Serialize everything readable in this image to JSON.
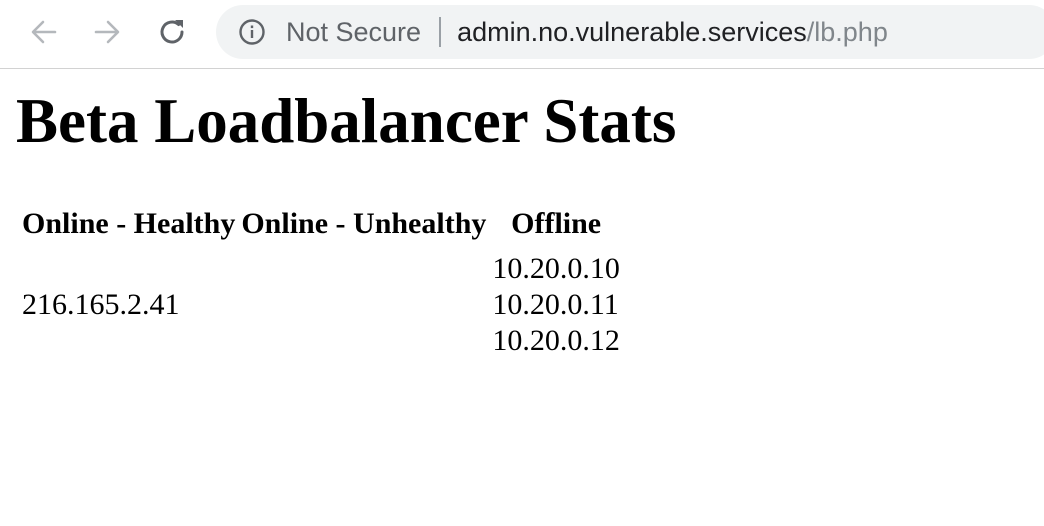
{
  "browser": {
    "security_label": "Not Secure",
    "url_host": "admin.no.vulnerable.services",
    "url_path": "/lb.php",
    "icons": {
      "back": "arrow-left-icon",
      "forward": "arrow-right-icon",
      "reload": "reload-icon",
      "info": "info-circle-icon"
    }
  },
  "page": {
    "title": "Beta Loadbalancer Stats",
    "table": {
      "headers": {
        "online_healthy": "Online - Healthy",
        "online_unhealthy": "Online - Unhealthy",
        "offline": "Offline"
      },
      "online_healthy": [
        "216.165.2.41"
      ],
      "online_unhealthy": [],
      "offline": [
        "10.20.0.10",
        "10.20.0.11",
        "10.20.0.12"
      ]
    }
  }
}
